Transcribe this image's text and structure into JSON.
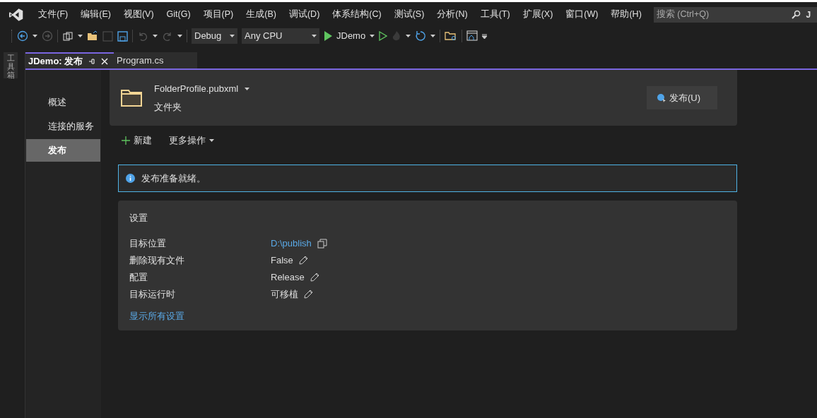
{
  "menu": [
    "文件(F)",
    "编辑(E)",
    "视图(V)",
    "Git(G)",
    "项目(P)",
    "生成(B)",
    "调试(D)",
    "体系结构(C)",
    "测试(S)",
    "分析(N)",
    "工具(T)",
    "扩展(X)",
    "窗口(W)",
    "帮助(H)"
  ],
  "search": {
    "placeholder": "搜索 (Ctrl+Q)"
  },
  "account_badge": "J",
  "toolbar": {
    "configuration": "Debug",
    "platform": "Any CPU",
    "start_target": "JDemo"
  },
  "toolbox_label": "工具箱",
  "tabs": [
    {
      "label": "JDemo: 发布",
      "selected": true
    },
    {
      "label": "Program.cs",
      "selected": false
    }
  ],
  "nav": [
    {
      "label": "概述",
      "selected": false
    },
    {
      "label": "连接的服务",
      "selected": false
    },
    {
      "label": "发布",
      "selected": true
    }
  ],
  "profile": {
    "name": "FolderProfile.pubxml",
    "type": "文件夹",
    "publish_button": "发布(U)"
  },
  "actions": {
    "new": "新建",
    "more": "更多操作"
  },
  "info": "发布准备就绪。",
  "settings": {
    "title": "设置",
    "rows": [
      {
        "label": "目标位置",
        "value": "D:\\publish",
        "kind": "link"
      },
      {
        "label": "删除现有文件",
        "value": "False",
        "kind": "editable"
      },
      {
        "label": "配置",
        "value": "Release",
        "kind": "editable"
      },
      {
        "label": "目标运行时",
        "value": "可移植",
        "kind": "editable"
      }
    ],
    "show_all": "显示所有设置"
  }
}
